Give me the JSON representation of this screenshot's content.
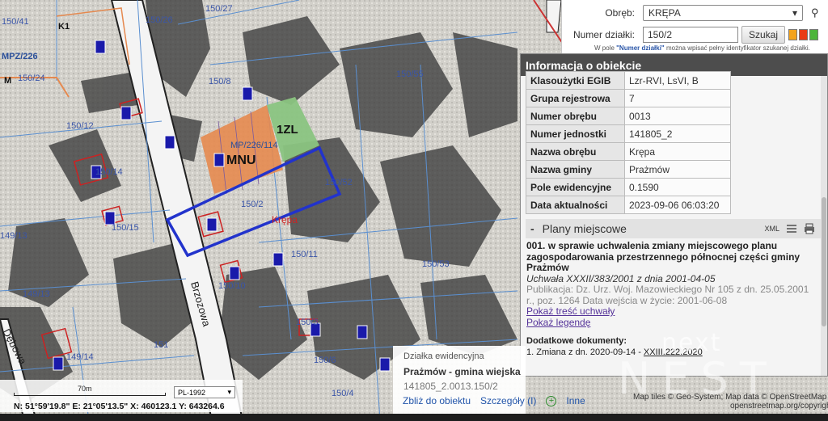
{
  "colors": {
    "accent_blue": "#2233cc",
    "mnu_orange": "#e5894f",
    "zl_green": "#8ac481",
    "label_blue": "#3a55a8",
    "header_dark": "#4d4d4d"
  },
  "map": {
    "parcel_labels": [
      "150/41",
      "150/26",
      "150/27",
      "150/24",
      "150/8",
      "150/55",
      "150/12",
      "150/14",
      "150/2",
      "150/52",
      "150/15",
      "149/13",
      "150/11",
      "150/53",
      "150/10",
      "149/13",
      "149/14",
      "151",
      "150/3",
      "150/4",
      "150/6"
    ],
    "zone_mnu": "MNU",
    "zone_zl": "1ZL",
    "zone_code": "MPZ/226",
    "zone_code_2": "MP/226/114",
    "village_label": "Krępa",
    "street_1": "Brzozowa",
    "street_2": "Dębowa",
    "marker_k1": "K1",
    "marker_m": "M"
  },
  "search": {
    "obreb_label": "Obręb:",
    "obreb_value": "KRĘPA",
    "numer_label": "Numer działki:",
    "numer_value": "150/2",
    "search_button": "Szukaj",
    "hint_prefix": "W pole ",
    "hint_bold": "\"Numer działki\"",
    "hint_suffix": " można wpisać pełny identyfikator szukanej działki.",
    "color_squares": [
      "#f4a31c",
      "#ea3a17",
      "#4db53a"
    ]
  },
  "info": {
    "title": "Informacja o obiekcie",
    "rows": [
      {
        "k": "Klasoużytki EGIB",
        "v": "Lzr-RVI, LsVI, B"
      },
      {
        "k": "Grupa rejestrowa",
        "v": "7"
      },
      {
        "k": "Numer obrębu",
        "v": "0013"
      },
      {
        "k": "Numer jednostki",
        "v": "141805_2"
      },
      {
        "k": "Nazwa obrębu",
        "v": "Krępa"
      },
      {
        "k": "Nazwa gminy",
        "v": "Prażmów"
      },
      {
        "k": "Pole ewidencyjne",
        "v": "0.1590"
      },
      {
        "k": "Data aktualności",
        "v": "2023-09-06 06:03:20"
      }
    ],
    "plany_toggle": "-",
    "plany_title": "Plany miejscowe",
    "plany_xml": "XML",
    "plan_title": "001. w sprawie uchwalenia zmiany miejscowego planu zagospodarowania przestrzennego północnej części gminy Prażmów",
    "plan_subtitle": "Uchwała XXXII/383/2001 z dnia 2001-04-05",
    "plan_meta": "Publikacja: Dz. Urz. Woj. Mazowieckiego Nr 105 z dn. 25.05.2001 r., poz. 1264 Data wejścia w życie: 2001-06-08",
    "link_tresc": "Pokaż treść uchwały",
    "link_legenda": "Pokaż legendę",
    "extra_title": "Dodatkowe dokumenty:",
    "extra_item_prefix": "1. Zmiana z dn. 2020-09-14 - ",
    "extra_item_link": "XXIII.222.2020"
  },
  "popup": {
    "type": "Działka ewidencyjna",
    "name": "Prażmów - gmina wiejska",
    "id": "141805_2.0013.150/2",
    "zoom_link": "Zbliż do obiektu",
    "details_link": "Szczegóły (I)",
    "more_link": "Inne",
    "plus_icon": "+"
  },
  "status": {
    "scale_label": "70m",
    "crs": "PL-1992",
    "coords": "N: 51°59'19.8\"  E: 21°05'13.5\"  X: 460123.1  Y: 643264.6",
    "attribution": "Map tiles © Geo-System; Map data © OpenStreetMap",
    "attribution2": "openstreetmap.org/copyright"
  },
  "watermark": {
    "line1": "next",
    "line2": "NEST"
  }
}
